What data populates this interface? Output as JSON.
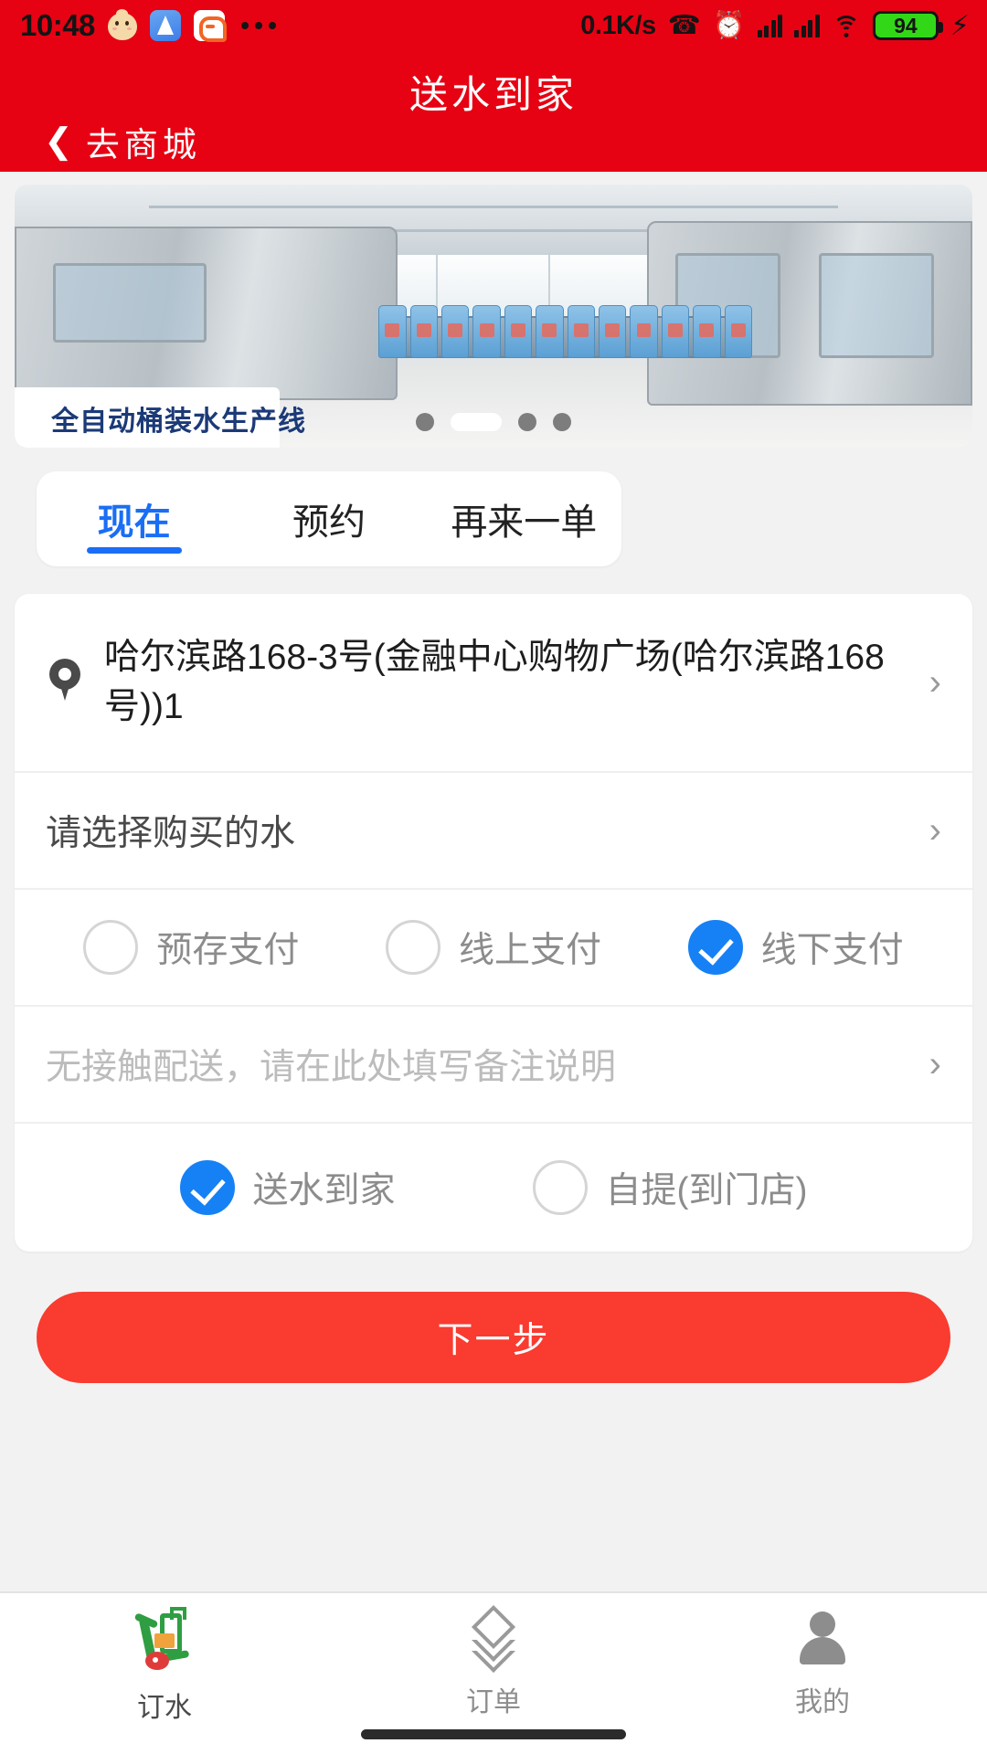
{
  "status_bar": {
    "time": "10:48",
    "network_speed": "0.1K/s",
    "battery_level": "94",
    "icons": [
      "egg-app-icon",
      "blue-triangle-app-icon",
      "didi-app-icon",
      "more-dots-icon",
      "bluetooth-icon",
      "alarm-icon",
      "signal-icon",
      "signal-icon",
      "wifi-icon",
      "battery-icon",
      "charging-icon"
    ]
  },
  "header": {
    "title": "送水到家",
    "back_label": "去商城",
    "back_icon": "chevron-left-icon",
    "brand_color": "#E60213"
  },
  "banner": {
    "caption": "全自动桶装水生产线",
    "total_dots": 4,
    "active_index": 1
  },
  "tabs": [
    {
      "label": "现在",
      "active": true
    },
    {
      "label": "预约",
      "active": false
    },
    {
      "label": "再来一单",
      "active": false
    }
  ],
  "form": {
    "address": {
      "icon": "location-pin-icon",
      "value": "哈尔滨路168-3号(金融中心购物广场(哈尔滨路168号))1",
      "chevron": "›"
    },
    "product": {
      "label": "请选择购买的水",
      "chevron": "›"
    },
    "payment_methods": [
      {
        "label": "预存支付",
        "checked": false
      },
      {
        "label": "线上支付",
        "checked": false
      },
      {
        "label": "线下支付",
        "checked": true
      }
    ],
    "remark": {
      "placeholder": "无接触配送，请在此处填写备注说明",
      "value": "",
      "chevron": "›"
    },
    "delivery_methods": [
      {
        "label": "送水到家",
        "checked": true
      },
      {
        "label": "自提(到门店)",
        "checked": false
      }
    ]
  },
  "next_button": {
    "label": "下一步",
    "color": "#F93B30"
  },
  "bottom_nav": [
    {
      "label": "订水",
      "icon": "water-trolley-icon",
      "active": true
    },
    {
      "label": "订单",
      "icon": "layers-icon",
      "active": false
    },
    {
      "label": "我的",
      "icon": "person-icon",
      "active": false
    }
  ],
  "accent_colors": {
    "brand_red": "#E60213",
    "button_red": "#F93B30",
    "tab_blue": "#1A6EF5",
    "check_blue": "#1681F5"
  }
}
